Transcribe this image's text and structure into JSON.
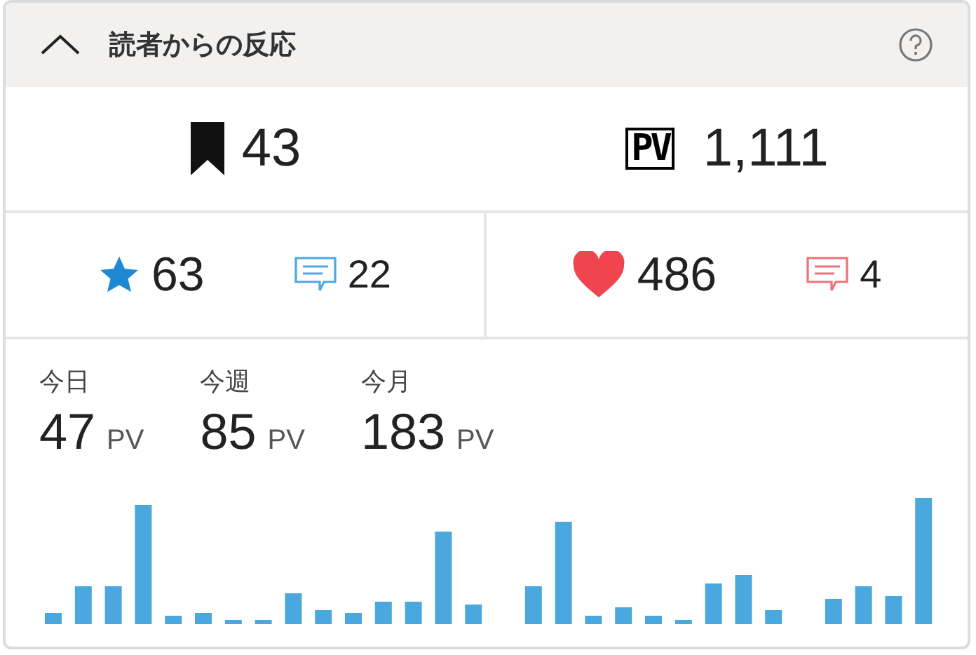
{
  "panel": {
    "title": "読者からの反応",
    "expanded": true
  },
  "totals": [
    {
      "kind": "bookmark",
      "value": "43"
    },
    {
      "kind": "pv",
      "label": "PV",
      "value": "1,111"
    }
  ],
  "reactions": [
    {
      "kind": "star",
      "value": "63",
      "color": "#1e88d2"
    },
    {
      "kind": "comment",
      "value": "22",
      "color": "#4ca8e0"
    },
    {
      "kind": "heart",
      "value": "486",
      "color": "#f0444f"
    },
    {
      "kind": "comment",
      "value": "4",
      "color": "#f0707a"
    }
  ],
  "periods": [
    {
      "label": "今日",
      "value": "47",
      "unit": "PV"
    },
    {
      "label": "今週",
      "value": "85",
      "unit": "PV"
    },
    {
      "label": "今月",
      "value": "183",
      "unit": "PV"
    }
  ]
}
